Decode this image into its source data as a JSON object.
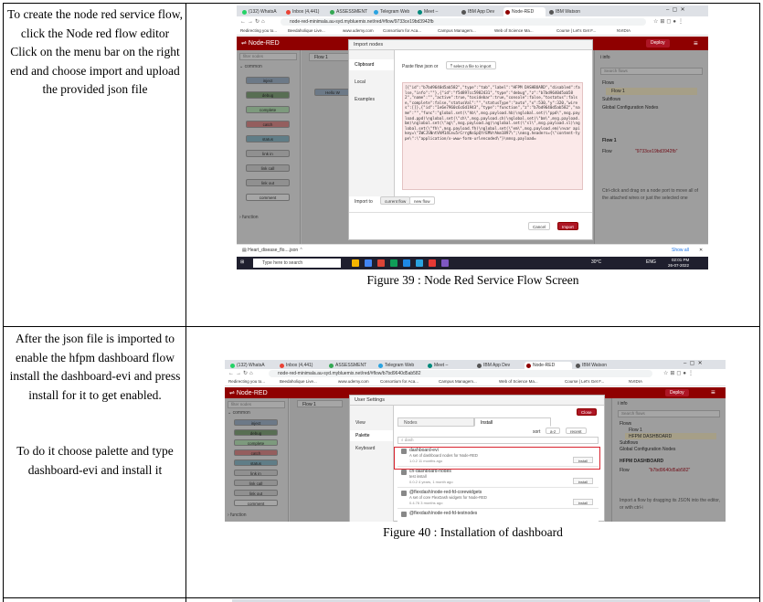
{
  "rows": [
    {
      "instruction": "To create the node red service flow, click the Node red flow editor\nClick on the menu bar on the right end and choose import and upload the provided json file",
      "figure_caption": "Figure 39 : Node Red Service Flow Screen"
    },
    {
      "instruction_p1": "After the json file is imported to enable the hfpm dashboard flow install the dashboard-evi and press install for it to get enabled.",
      "instruction_p2": "To do it choose palette and type dashboard-evi and install it",
      "figure_caption": "Figure 40 : Installation of dashboard"
    }
  ],
  "screenshot1": {
    "browser_tabs": [
      "(132) WhatsA",
      "Inbox (4,441)",
      "ASSESSMENT",
      "Telegram Web",
      "Meet –",
      "IBM App Dev",
      "Node-RED",
      "IBM Watson"
    ],
    "url": "node-red-minimala.au-syd.mybluemix.net/red/#flow/9733ce19bd3942fb",
    "bookmarks": [
      "Redirecting you to...",
      "Beedaholique Live...",
      "www.udemy.com",
      "Consortium for Aca...",
      "Campus Managem...",
      "Web of Science Ma...",
      "Course | Let's Get F...",
      "NVIDIA"
    ],
    "app_name": "Node-RED",
    "deploy_label": "Deploy",
    "palette_filter": "filter nodes",
    "palette_category": "common",
    "palette_nodes": [
      "inject",
      "debug",
      "complete",
      "catch",
      "status",
      "link in",
      "link call",
      "link out",
      "comment"
    ],
    "palette_category2": "function",
    "workspace_tab": "Flow 1",
    "canvas_node": "Hello W",
    "dialog": {
      "title": "Import nodes",
      "sources": [
        "Clipboard",
        "Local",
        "Examples"
      ],
      "paste_label": "Paste flow json or",
      "select_file": "select a file to import",
      "json_text": "[{\"id\":\"b7bd9640d5ab582\",\"type\":\"tab\",\"label\":\"HFPM DASHBOARD\",\"disabled\":false,\"info\":\"\"},{\"id\":\"f5d897cc5982431\",\"type\":\"debug\",\"z\":\"b7bd9640d5ab582\",\"name\":\"\",\"active\":true,\"tosidebar\":true,\"console\":false,\"tostatus\":false,\"complete\":false,\"statusVal\":\"\",\"statusType\":\"auto\",\"x\":530,\"y\":320,\"wires\":[]},{\"id\":\"1e6e7960c6c6d1943\",\"type\":\"function\",\"z\":\"b7bd9640d5ab582\",\"name\":\"\",\"func\":\"global.set(\\\"hb\\\",msg.payload.hb)\\nglobal.set(\\\"ppd\\\",msg.payload.ppd)\\nglobal.set(\\\"ch\\\",msg.payload.ch)\\nglobal.set(\\\"bm\\\",msg.payload.bm)\\nglobal.set(\\\"ag\\\",msg.payload.ag)\\nglobal.set(\\\"sl\\\",msg.payload.sl)\\nglobal.set(\\\"fh\\\",msg.payload.fh)\\nglobal.set(\\\"em\\\",msg.payload.em)\\nvar apikey=\\\"IWCJSNntVhM14Ceu5rCrrgNsGpQYrEMVrAkm1897\\\";\\nmsg.headers={\\\"content-type\\\":\\\"application/x-www-form-urlencoded\\\"}\\nmsg.payload=",
      "import_to_label": "Import to",
      "import_targets": [
        "current flow",
        "new flow"
      ],
      "cancel": "Cancel",
      "import": "Import"
    },
    "sidebar": {
      "title": "info",
      "search": "Search flows",
      "tree": [
        "Flows",
        "Flow 1",
        "Subflows",
        "Global Configuration Nodes"
      ],
      "section": "Flow 1",
      "flow_label": "Flow",
      "flow_id": "\"9733ce19bd3942fb\"",
      "help": "Ctrl-click and drag on a node port to move all of the attached wires or just the selected one"
    },
    "download_file": "Heart_disease_flo....json",
    "show_all": "Show all",
    "taskbar": {
      "search": "Type here to search",
      "weather": "30°C",
      "lang": "ENG",
      "time": "02:01 PM",
      "date": "26-07-2022"
    }
  },
  "screenshot2": {
    "browser_tabs": [
      "(132) WhatsA",
      "Inbox (4,441)",
      "ASSESSMENT",
      "Telegram Web",
      "Meet –",
      "IBM App Dev",
      "Node-RED",
      "IBM Watson"
    ],
    "url": "node-red-minimala.au-syd.mybluemix.net/red/#flow/b7bd9640d5ab582",
    "dialog_title": "User Settings",
    "close": "Close",
    "settings_nav": [
      "View",
      "Palette",
      "Keyboard"
    ],
    "tabs": [
      "Nodes",
      "Install"
    ],
    "sort_label": "sort",
    "sort_options": [
      "a-z",
      "recent"
    ],
    "search_value": "dash",
    "packages": [
      {
        "name": "dashboard-evi",
        "desc": "A set of dashboard nodes for Node-RED",
        "meta": "1.0.2   11 months ago",
        "btn": "install"
      },
      {
        "name": "cn-dashboard-nodes",
        "desc": "test install",
        "meta": "0.0.2   4 years, 1 month ago",
        "btn": "install"
      },
      {
        "name": "@flexdash/node-red-fd-corewidgets",
        "desc": "A set of core FlexDash widgets for Node-RED",
        "meta": "0.4.76   3 months ago",
        "btn": "install"
      },
      {
        "name": "@flexdash/node-red-fd-testnodes",
        "desc": "",
        "meta": "",
        "btn": ""
      }
    ],
    "palette_nodes": [
      "inject",
      "debug",
      "complete",
      "catch",
      "status",
      "link in",
      "link call",
      "link out",
      "comment"
    ],
    "workspace_tab": "Flow 1",
    "sidebar_section": "HFPM DASHBOARD",
    "flow_id": "\"b7bd9640d5ab582\"",
    "help": "Import a flow by dragging its JSON into the editor, or with ctrl-i"
  }
}
